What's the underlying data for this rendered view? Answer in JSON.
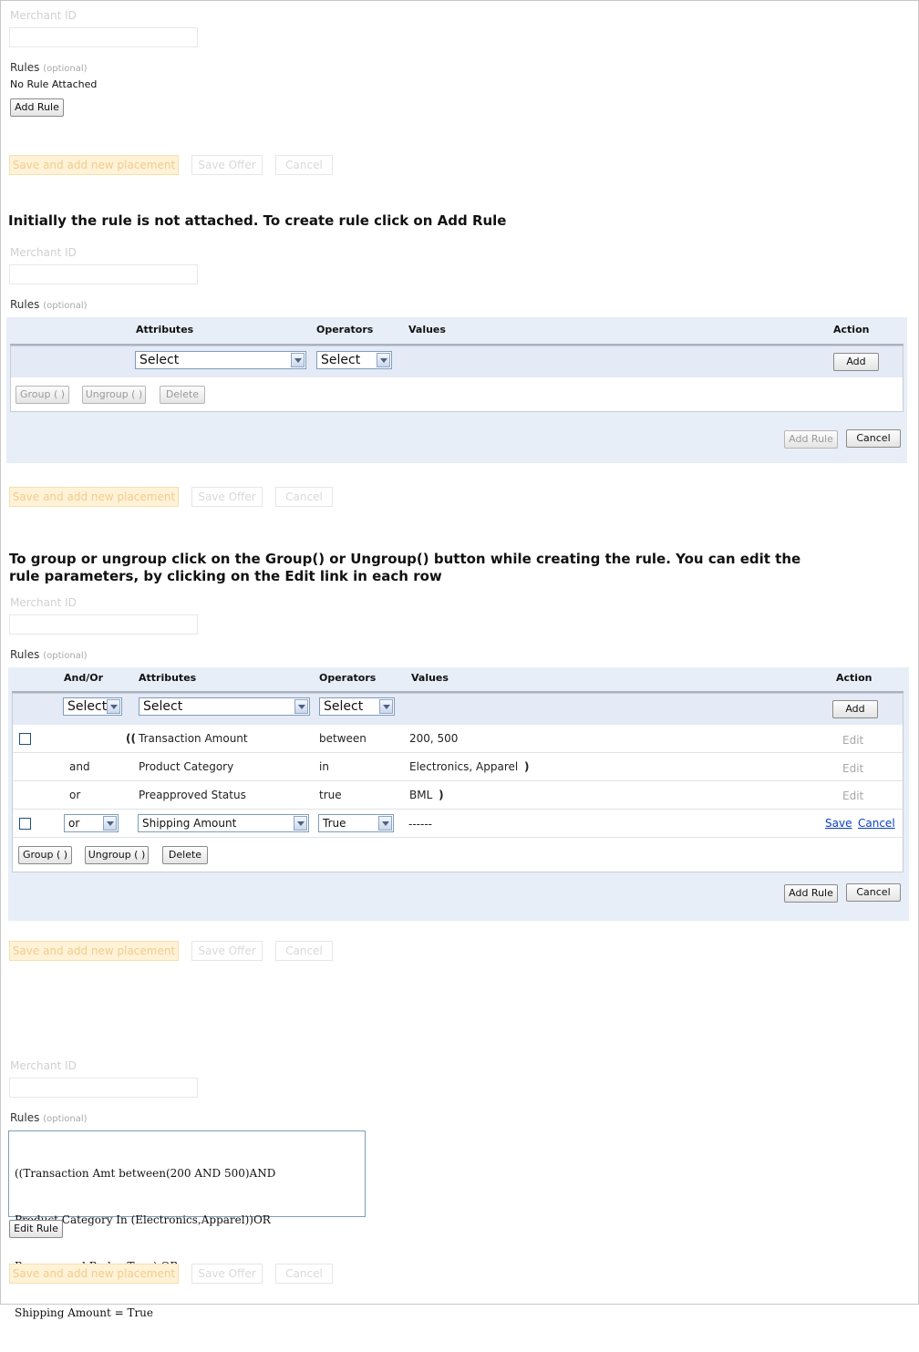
{
  "merchant_id_label": "Merchant ID",
  "rules_label": "Rules",
  "optional_label": "(optional)",
  "no_rule_text": "No Rule Attached",
  "add_rule_button": "Add Rule",
  "edit_rule_button": "Edit Rule",
  "footer": {
    "save_add_placement": "Save and add new placement",
    "save_offer": "Save Offer",
    "cancel": "Cancel"
  },
  "heading1": "Initially the rule is not attached. To create rule click on Add Rule",
  "heading2_line1": "To group or ungroup click on the Group() or Ungroup() button while creating the rule. You can edit the",
  "heading2_line2": "rule parameters, by clicking on the Edit link in each row",
  "table_headers": {
    "and_or": "And/Or",
    "attributes": "Attributes",
    "operators": "Operators",
    "values": "Values",
    "action": "Action"
  },
  "select_placeholder": "Select",
  "add_button": "Add",
  "cancel_button": "Cancel",
  "group_button": "Group ( )",
  "ungroup_button": "Ungroup ( )",
  "delete_button": "Delete",
  "rule_rows": [
    {
      "and_or": "",
      "paren_open": "((",
      "attribute": "Transaction Amount",
      "operator": "between",
      "value": "200, 500",
      "paren_close": "",
      "action": "Edit"
    },
    {
      "and_or": "and",
      "paren_open": "",
      "attribute": "Product Category",
      "operator": "in",
      "value": "Electronics, Apparel",
      "paren_close": ")",
      "action": "Edit"
    },
    {
      "and_or": "or",
      "paren_open": "",
      "attribute": "Preapproved Status",
      "operator": "true",
      "value": "BML",
      "paren_close": ")",
      "action": "Edit"
    }
  ],
  "edit_row": {
    "and_or": "or",
    "attribute": "Shipping Amount",
    "operator": "True",
    "value": "------",
    "save_link": "Save",
    "cancel_link": "Cancel"
  },
  "rule_text_lines": [
    "((Transaction Amt between(200 AND 500)AND",
    "Product Category In (Electronics,Apparel))OR",
    "Preapproved.Bml = True) OR",
    "Shipping Amount = True"
  ],
  "colors": {
    "panel_bg": "#e8eef8",
    "link_blue": "#0b3fc0",
    "disabled_orange": "#fff2d6"
  }
}
